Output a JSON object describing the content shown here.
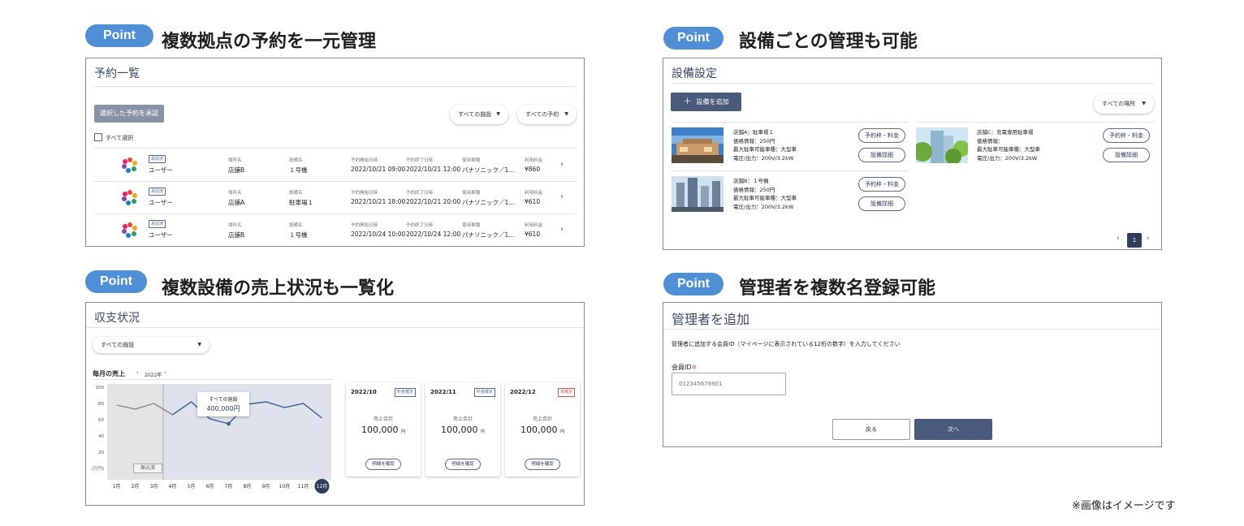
{
  "points": [
    {
      "pill": "Point",
      "heading": "複数拠点の予約を一元管理"
    },
    {
      "pill": "Point",
      "heading": "設備ごとの管理も可能"
    },
    {
      "pill": "Point",
      "heading": "複数設備の売上状況も一覧化"
    },
    {
      "pill": "Point",
      "heading": "管理者を複数名登録可能"
    }
  ],
  "reservations": {
    "title": "予約一覧",
    "approve_button": "選択した予約を承認",
    "facility_filter": "すべての施設",
    "reservation_filter": "すべての予約",
    "select_all": "すべて選択",
    "col_labels": {
      "place": "場所名",
      "equipment": "設備名",
      "start": "予約開始日時",
      "end": "予約終了日時",
      "vehicle": "使用車種",
      "fee": "利用料金"
    },
    "rows": [
      {
        "badge": "承認済",
        "user": "ユーザー",
        "place": "店舗B",
        "equipment": "１号機",
        "start": "2022/10/21 09:00",
        "end": "2022/10/21 12:00",
        "vehicle": "パナソニック／1...",
        "fee": "¥860"
      },
      {
        "badge": "承認済",
        "user": "ユーザー",
        "place": "店舗A",
        "equipment": "駐車場１",
        "start": "2022/10/21 18:00",
        "end": "2022/10/21 20:00",
        "vehicle": "パナソニック／1...",
        "fee": "¥610"
      },
      {
        "badge": "承認済",
        "user": "ユーザー",
        "place": "店舗B",
        "equipment": "１号機",
        "start": "2022/10/24 10:00",
        "end": "2022/10/24 12:00",
        "vehicle": "パナソニック／1...",
        "fee": "¥610"
      }
    ]
  },
  "equipment": {
    "title": "設備設定",
    "add_button": "設備を追加",
    "add_icon": "＋",
    "place_filter": "すべての場所",
    "items": [
      {
        "lines": [
          "店舗A：駐車場１",
          "価格情報：250円",
          "最大駐車可能車種：大型車",
          "電圧/出力：200V/3.2kW"
        ],
        "btn1": "予約枠・料金",
        "btn2": "設備詳細"
      },
      {
        "lines": [
          "店舗C：充電専用駐車場",
          "価格情報：",
          "最大駐車可能車種：大型車",
          "電圧/出力：200V/3.2kW"
        ],
        "btn1": "予約枠・料金",
        "btn2": "設備詳細"
      },
      {
        "lines": [
          "店舗B：１号機",
          "価格情報：250円",
          "最大駐車可能車種：大型車",
          "電圧/出力：200V/3.2kW"
        ],
        "btn1": "予約枠・料金",
        "btn2": "設備詳細"
      }
    ],
    "page": "1"
  },
  "sales": {
    "title": "収支状況",
    "facility_filter": "すべての施設",
    "monthly_label": "毎月の売上",
    "year": "2022年",
    "tooltip_title": "すべての施設",
    "tooltip_value": "400,000円",
    "paid_label": "振込済",
    "cards": [
      {
        "month": "2022/10",
        "status": "料金確定",
        "label": "売上合計",
        "amount": "100,000",
        "unit": "円",
        "button": "明細を確認",
        "status_color": "#4e6a9a"
      },
      {
        "month": "2022/11",
        "status": "料金確定",
        "label": "売上合計",
        "amount": "100,000",
        "unit": "円",
        "button": "明細を確認",
        "status_color": "#4e6a9a"
      },
      {
        "month": "2022/12",
        "status": "未確定",
        "label": "売上合計",
        "amount": "100,000",
        "unit": "円",
        "button": "明細を確認",
        "status_color": "#d9534f"
      }
    ]
  },
  "chart_data": {
    "type": "line",
    "categories": [
      "1月",
      "2月",
      "3月",
      "4月",
      "5月",
      "6月",
      "7月",
      "8月",
      "9月",
      "10月",
      "11月",
      "12月"
    ],
    "series": [
      {
        "values": [
          78,
          73,
          80,
          66,
          82,
          61,
          55,
          79,
          82,
          75,
          80,
          62
        ]
      }
    ],
    "ylim": [
      0,
      100
    ],
    "yticks": [
      "100",
      "80",
      "60",
      "40",
      "20",
      "(万円)"
    ],
    "selected_category": "12月",
    "highlight_index": 6,
    "paid_through_index": 2
  },
  "admin": {
    "title": "管理者を追加",
    "description": "管理者に追加する会員ID（マイページに表示されている12桁の数字）を入力してください",
    "field_label": "会員ID",
    "required_mark": "※",
    "placeholder": "012345678901",
    "back": "戻る",
    "next": "次へ"
  },
  "note": "※画像はイメージです"
}
